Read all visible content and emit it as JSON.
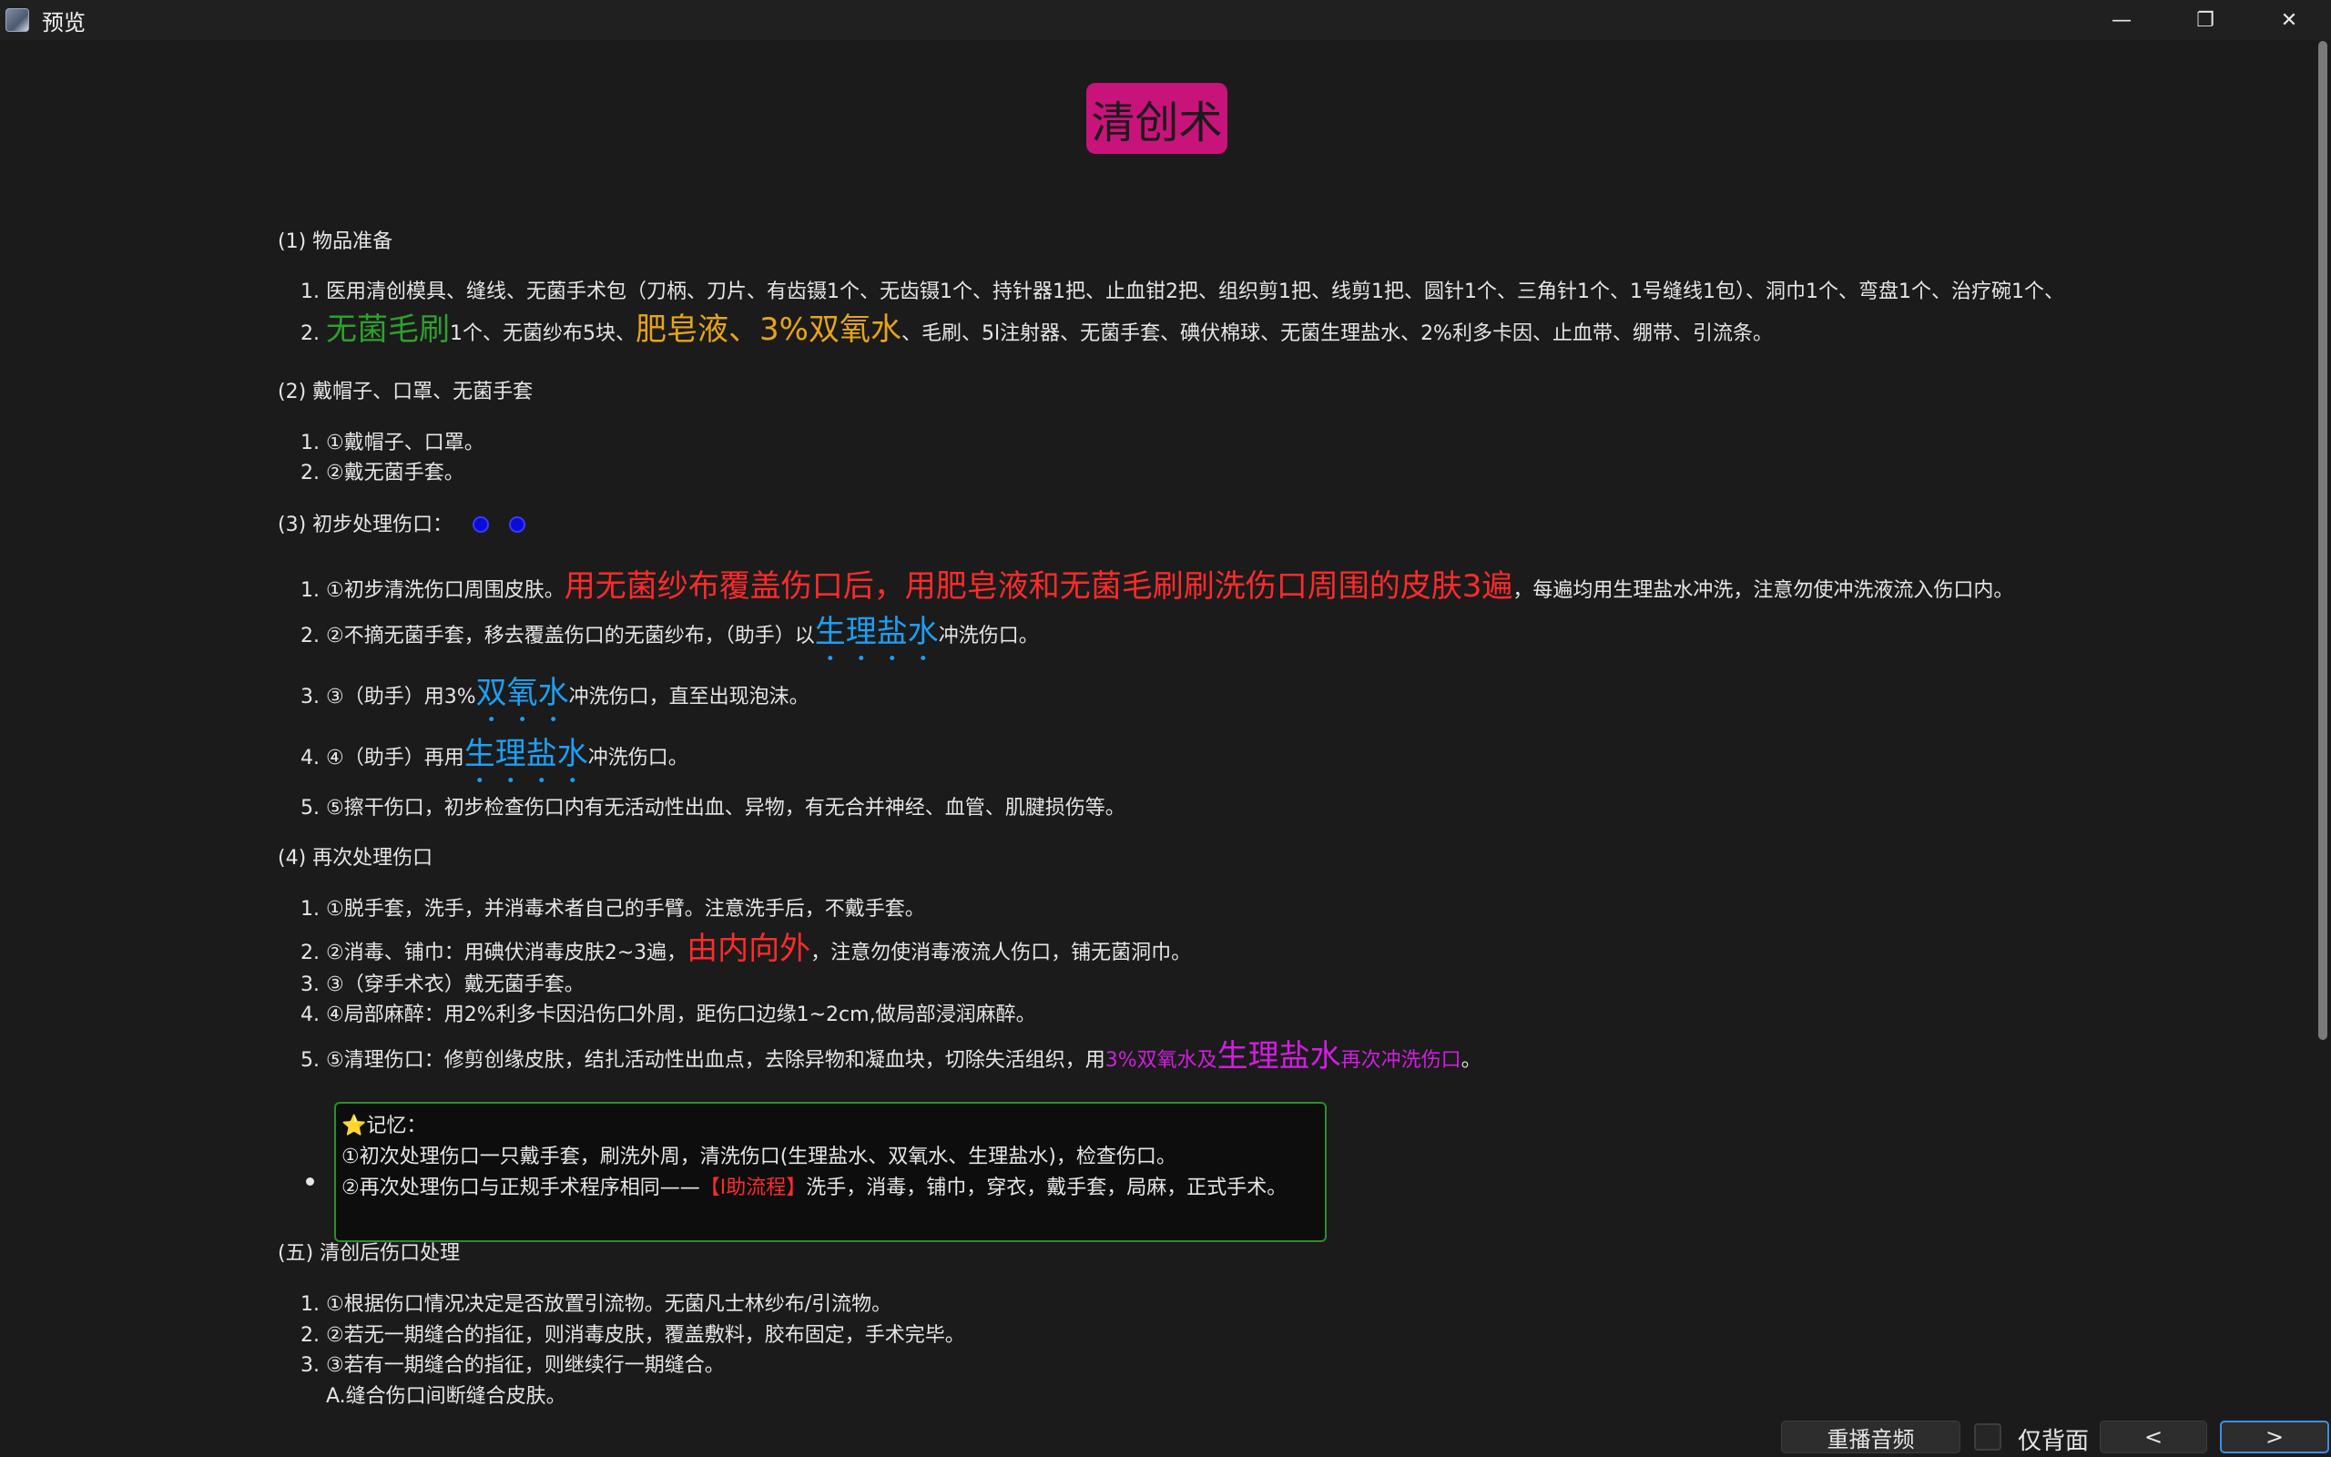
{
  "window": {
    "title": "预览",
    "controls": [
      "—",
      "❐",
      "✕"
    ]
  },
  "page": {
    "title": "清创术",
    "sections": {
      "s1": {
        "title": "(1) 物品准备",
        "items": [
          "医用清创模具、缝线、无菌手术包（刀柄、刀片、有齿镊1个、无齿镊1个、持针器1把、止血钳2把、组织剪1把、线剪1把、圆针1个、三角针1个、1号缝线1包）、洞巾1个、弯盘1个、治疗碗1个、",
          {
            "a": "无菌毛刷",
            "b": "1个、无菌纱布5块、",
            "c": "肥皂液、3%双氧水",
            "d": "、毛刷、5l注射器、无菌手套、碘伏棉球、无菌生理盐水、2%利多卡因、止血带、绷带、引流条。"
          }
        ]
      },
      "s2": {
        "title": "(2) 戴帽子、口罩、无菌手套",
        "items": [
          "①戴帽子、口罩。",
          "②戴无菌手套。"
        ]
      },
      "s3": {
        "title": "(3) 初步处理伤口：",
        "items": [
          {
            "a": "①初步清洗伤口周围皮肤。",
            "b": "用无菌纱布覆盖伤口后，用肥皂液和无菌毛刷刷洗伤口周围的皮肤3遍",
            "c": "，每遍均用生理盐水冲洗，注意勿使冲洗液流入伤口内。"
          },
          {
            "a": "②不摘无菌手套，移去覆盖伤口的无菌纱布，（助手）以",
            "b": "生理盐水",
            "c": "冲洗伤口。"
          },
          {
            "a": "③（助手）用3%",
            "b": "双氧水",
            "c": "冲洗伤口，直至出现泡沫。"
          },
          {
            "a": "④（助手）再用",
            "b": "生理盐水",
            "c": "冲洗伤口。"
          },
          "⑤擦干伤口，初步检查伤口内有无活动性出血、异物，有无合并神经、血管、肌腱损伤等。"
        ]
      },
      "s4": {
        "title": "(4) 再次处理伤口",
        "items": [
          "①脱手套，洗手，并消毒术者自己的手臂。注意洗手后，不戴手套。",
          {
            "a": "②消毒、铺巾：用碘伏消毒皮肤2~3遍，",
            "b": "由内向外",
            "c": "，注意勿使消毒液流人伤口，铺无菌洞巾。"
          },
          "③（穿手术衣）戴无菌手套。",
          "④局部麻醉：用2%利多卡因沿伤口外周，距伤口边缘1~2cm,做局部浸润麻醉。",
          {
            "a": "⑤清理伤口：修剪创缘皮肤，结扎活动性出血点，去除异物和凝血块，切除失活组织，用",
            "b": "3%双氧水及",
            "c": "生理盐水",
            "d": "再次冲洗伤口",
            "e": "。"
          }
        ]
      },
      "memo": {
        "star": "⭐",
        "label": "记忆：",
        "line1": "①初次处理伤口一只戴手套，刷洗外周，清洗伤口(生理盐水、双氧水、生理盐水)，检查伤口。",
        "line2a": "②再次处理伤口与正规手术程序相同——",
        "line2b": "【Ⅰ助流程】",
        "line2c": "洗手，消毒，铺巾，穿衣，戴手套，局麻，正式手术。"
      },
      "s5": {
        "title": "(五) 清创后伤口处理",
        "items": [
          "①根据伤口情况决定是否放置引流物。无菌凡士林纱布/引流物。",
          "②若无一期缝合的指征，则消毒皮肤，覆盖敷料，胶布固定，手术完毕。",
          "③若有一期缝合的指征，则继续行一期缝合。"
        ],
        "sub": "A.缝合伤口间断缝合皮肤。"
      }
    }
  },
  "footer": {
    "replay": "重播音频",
    "back_only": "仅背面",
    "prev": "<",
    "next": ">"
  }
}
